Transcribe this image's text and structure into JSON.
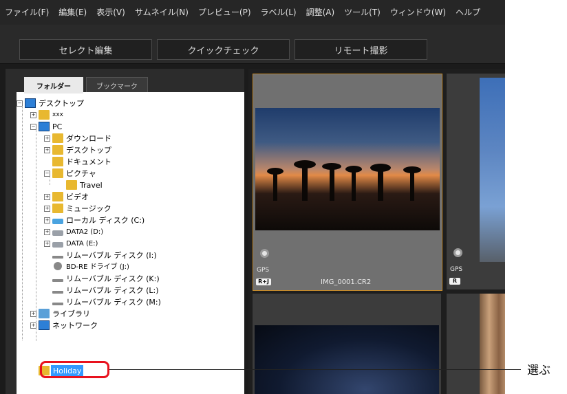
{
  "menubar": {
    "items": [
      "ファイル(F)",
      "編集(E)",
      "表示(V)",
      "サムネイル(N)",
      "プレビュー(P)",
      "ラベル(L)",
      "調整(A)",
      "ツール(T)",
      "ウィンドウ(W)",
      "ヘルプ"
    ]
  },
  "toolbar": {
    "buttons": [
      "セレクト編集",
      "クイックチェック",
      "リモート撮影"
    ]
  },
  "left_panel": {
    "tabs": [
      "フォルダー",
      "ブックマーク"
    ],
    "active_tab": "フォルダー",
    "tree": [
      {
        "label": "デスクトップ",
        "icon": "desktop-icon"
      },
      {
        "label": "xxx",
        "icon": "user-folder-icon"
      },
      {
        "label": "PC",
        "icon": "pc-icon"
      },
      {
        "label": "ダウンロード",
        "icon": "downloads-folder-icon"
      },
      {
        "label": "デスクトップ",
        "icon": "desktop-folder-icon"
      },
      {
        "label": "ドキュメント",
        "icon": "documents-folder-icon"
      },
      {
        "label": "ピクチャ",
        "icon": "pictures-folder-icon"
      },
      {
        "label": "Travel",
        "icon": "folder-icon"
      },
      {
        "label": "ビデオ",
        "icon": "videos-folder-icon"
      },
      {
        "label": "ミュージック",
        "icon": "music-folder-icon"
      },
      {
        "label": "ローカル ディスク (C:)",
        "icon": "local-disk-icon"
      },
      {
        "label": "DATA2 (D:)",
        "icon": "drive-icon"
      },
      {
        "label": "DATA (E:)",
        "icon": "drive-icon"
      },
      {
        "label": "リムーバブル ディスク (I:)",
        "icon": "removable-disk-icon"
      },
      {
        "label": "BD-RE ドライブ (J:)",
        "icon": "optical-drive-icon"
      },
      {
        "label": "リムーバブル ディスク (K:)",
        "icon": "removable-disk-icon"
      },
      {
        "label": "リムーバブル ディスク (L:)",
        "icon": "removable-disk-icon"
      },
      {
        "label": "リムーバブル ディスク (M:)",
        "icon": "removable-disk-icon"
      },
      {
        "label": "ライブラリ",
        "icon": "library-icon"
      },
      {
        "label": "ネットワーク",
        "icon": "network-icon"
      },
      {
        "label": "Holiday",
        "icon": "folder-icon",
        "selected": true
      }
    ]
  },
  "thumbnails": [
    {
      "gps": "GPS",
      "badge": "R+J",
      "filename": "IMG_0001.CR2",
      "selected": true
    },
    {
      "gps": "GPS",
      "badge": "R",
      "filename": "",
      "selected": false
    }
  ],
  "annotation": {
    "callout": "選ぶ",
    "highlight_color": "#e8121e"
  },
  "colors": {
    "app_bg": "#1b1b1b",
    "selection_border": "#c58b2d",
    "tree_selection": "#3399ff"
  }
}
